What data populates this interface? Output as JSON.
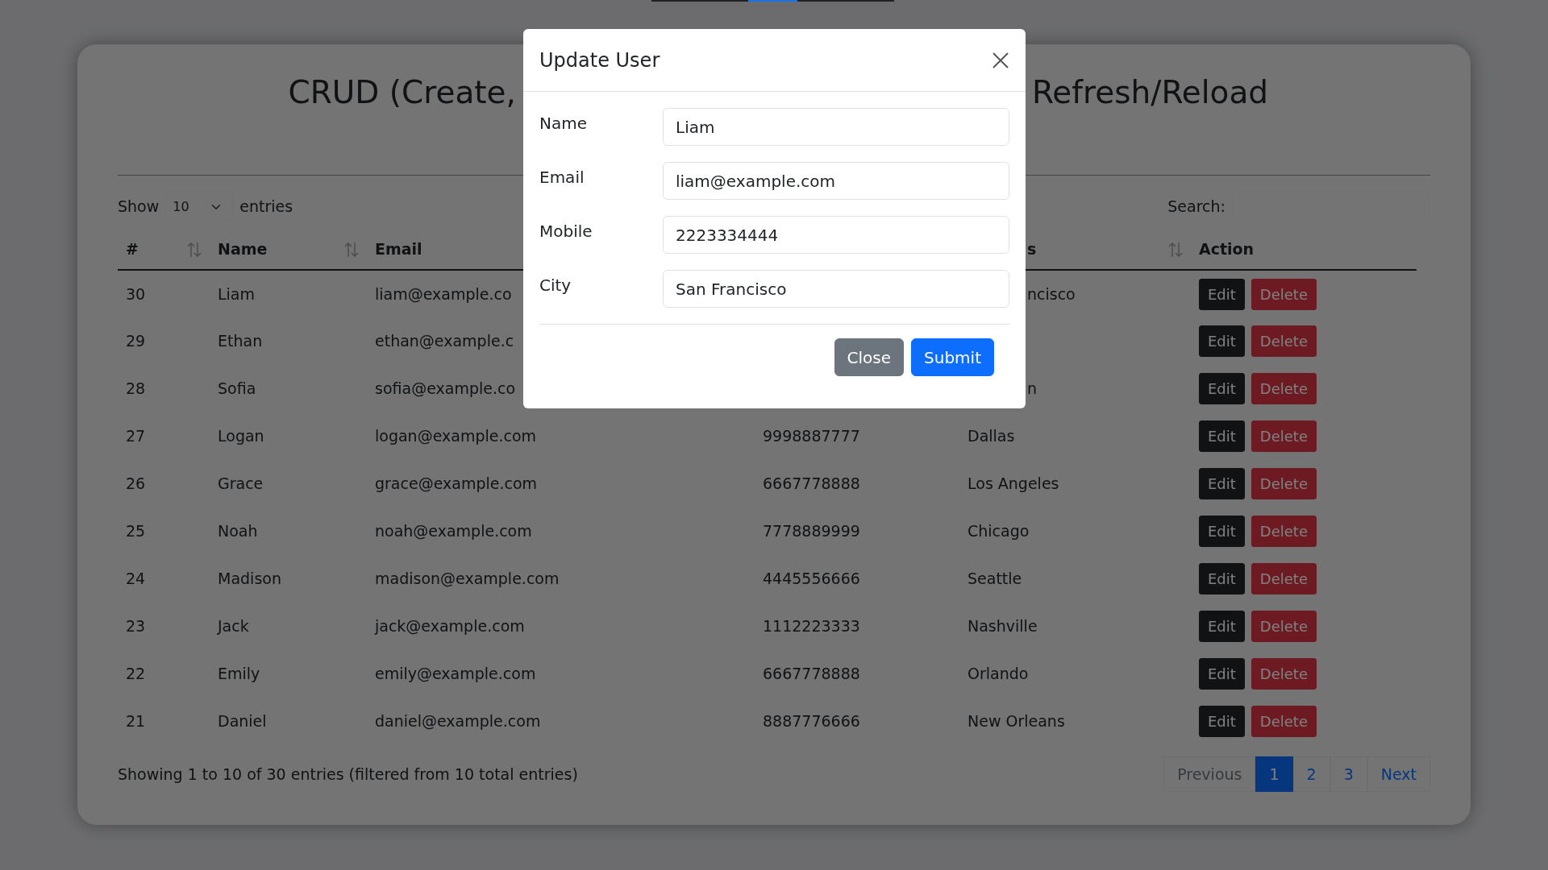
{
  "page": {
    "title_parts": [
      "CRUD (Create,",
      "Refresh/Reload"
    ]
  },
  "length_control": {
    "label_before": "Show",
    "value": "10",
    "label_after": "entries"
  },
  "search": {
    "label": "Search:"
  },
  "table": {
    "columns": [
      {
        "label": "#",
        "sort_icon": true
      },
      {
        "label": "Name",
        "sort_icon": true
      },
      {
        "label": "Email"
      },
      {},
      {
        "label": "s",
        "sort_icon": true
      },
      {
        "label": "Action",
        "sort_icon": false
      }
    ],
    "rows": [
      {
        "id": "30",
        "name": "Liam",
        "email": "liam@example.co",
        "city": "ncisco",
        "actions": [
          {
            "label": "Edit",
            "kind": "dark"
          },
          {
            "label": "Delete",
            "kind": "danger"
          }
        ]
      },
      {
        "id": "29",
        "name": "Ethan",
        "email": "ethan@example.c",
        "actions": [
          {
            "label": "Edit",
            "kind": "dark"
          },
          {
            "label": "Delete",
            "kind": "danger"
          }
        ]
      },
      {
        "id": "28",
        "name": "Sofia",
        "email": "sofia@example.co",
        "city": "n",
        "actions": [
          {
            "label": "Edit",
            "kind": "dark"
          },
          {
            "label": "Delete",
            "kind": "danger"
          }
        ]
      },
      {
        "id": "27",
        "name": "Logan",
        "email": "logan@example.com",
        "mobile": "9998887777",
        "city": "Dallas",
        "actions": [
          {
            "label": "Edit",
            "kind": "dark"
          },
          {
            "label": "Delete",
            "kind": "danger"
          }
        ]
      },
      {
        "id": "26",
        "name": "Grace",
        "email": "grace@example.com",
        "mobile": "6667778888",
        "city": "Los Angeles",
        "actions": [
          {
            "label": "Edit",
            "kind": "dark"
          },
          {
            "label": "Delete",
            "kind": "danger"
          }
        ]
      },
      {
        "id": "25",
        "name": "Noah",
        "email": "noah@example.com",
        "mobile": "7778889999",
        "city": "Chicago",
        "actions": [
          {
            "label": "Edit",
            "kind": "dark"
          },
          {
            "label": "Delete",
            "kind": "danger"
          }
        ]
      },
      {
        "id": "24",
        "name": "Madison",
        "email": "madison@example.com",
        "mobile": "4445556666",
        "city": "Seattle",
        "actions": [
          {
            "label": "Edit",
            "kind": "dark"
          },
          {
            "label": "Delete",
            "kind": "danger"
          }
        ]
      },
      {
        "id": "23",
        "name": "Jack",
        "email": "jack@example.com",
        "mobile": "1112223333",
        "city": "Nashville",
        "actions": [
          {
            "label": "Edit",
            "kind": "dark"
          },
          {
            "label": "Delete",
            "kind": "danger"
          }
        ]
      },
      {
        "id": "22",
        "name": "Emily",
        "email": "emily@example.com",
        "mobile": "6667778888",
        "city": "Orlando",
        "actions": [
          {
            "label": "Edit",
            "kind": "dark"
          },
          {
            "label": "Delete",
            "kind": "danger"
          }
        ]
      },
      {
        "id": "21",
        "name": "Daniel",
        "email": "daniel@example.com",
        "mobile": "8887776666",
        "city": "New Orleans",
        "actions": [
          {
            "label": "Edit",
            "kind": "dark"
          },
          {
            "label": "Delete",
            "kind": "danger"
          }
        ]
      }
    ]
  },
  "footer": {
    "info": "Showing 1 to 10 of 30 entries (filtered from 10 total entries)"
  },
  "pagination": [
    {
      "label": "Previous",
      "selected": false,
      "disabled": true
    },
    {
      "label": "1",
      "selected": true,
      "disabled": false
    },
    {
      "label": "2",
      "selected": false,
      "disabled": false
    },
    {
      "label": "3",
      "selected": false,
      "disabled": false
    },
    {
      "label": "Next",
      "selected": false,
      "disabled": false
    }
  ],
  "modal": {
    "title": "Update User",
    "fields": [
      {
        "label": "Name",
        "value": "Liam"
      },
      {
        "label": "Email",
        "value": "liam@example.com"
      },
      {
        "label": "Mobile",
        "value": "2223334444"
      },
      {
        "label": "City",
        "value": "San Francisco"
      }
    ],
    "buttons": [
      {
        "label": "Close",
        "kind": "secondary"
      },
      {
        "label": "Submit",
        "kind": "primary"
      }
    ]
  }
}
